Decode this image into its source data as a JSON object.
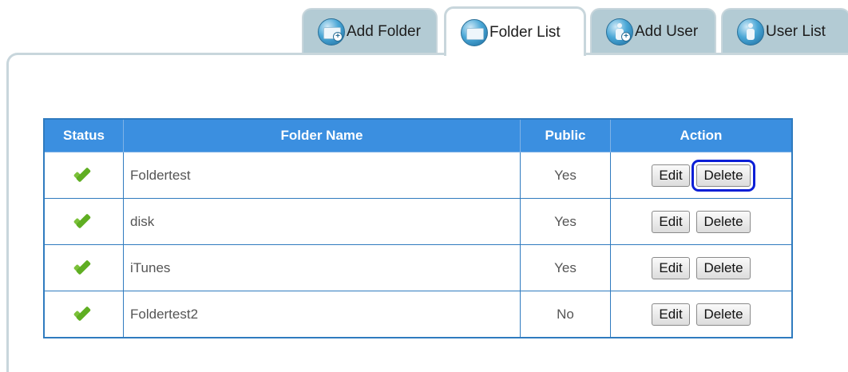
{
  "tabs": [
    {
      "label": "Add Folder",
      "icon": "add-folder-icon"
    },
    {
      "label": "Folder List",
      "icon": "folder-list-icon"
    },
    {
      "label": "Add User",
      "icon": "add-user-icon"
    },
    {
      "label": "User List",
      "icon": "user-list-icon"
    }
  ],
  "active_tab": "Folder List",
  "table": {
    "headers": {
      "status": "Status",
      "name": "Folder Name",
      "public": "Public",
      "action": "Action"
    },
    "rows": [
      {
        "status": "check-icon",
        "name": "Foldertest",
        "public": "Yes",
        "edit": "Edit",
        "delete": "Delete"
      },
      {
        "status": "check-icon",
        "name": "disk",
        "public": "Yes",
        "edit": "Edit",
        "delete": "Delete"
      },
      {
        "status": "check-icon",
        "name": "iTunes",
        "public": "Yes",
        "edit": "Edit",
        "delete": "Delete"
      },
      {
        "status": "check-icon",
        "name": "Foldertest2",
        "public": "No",
        "edit": "Edit",
        "delete": "Delete"
      }
    ]
  },
  "colors": {
    "header_bg": "#3b8fe0",
    "link": "#3d8fd6",
    "highlight": "#0b1fd6",
    "tab_bg": "#b3cbd4"
  }
}
